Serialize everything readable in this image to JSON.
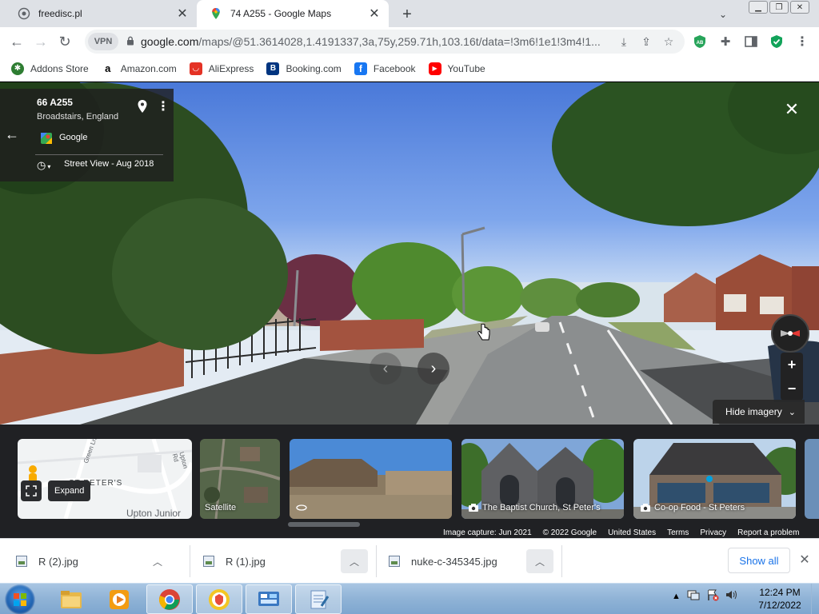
{
  "tabs": [
    {
      "title": "freedisc.pl"
    },
    {
      "title": "74 A255 - Google Maps"
    }
  ],
  "omnibox": {
    "vpn_label": "VPN",
    "url_host": "google.com",
    "url_path": "/maps/@51.3614028,1.4191337,3a,75y,259.71h,103.16t/data=!3m6!1e1!3m4!1..."
  },
  "bookmarks": [
    {
      "label": "Addons Store",
      "icon": "addons-icon",
      "color": "#2e7d32"
    },
    {
      "label": "Amazon.com",
      "icon": "amazon-icon",
      "color": "#000000"
    },
    {
      "label": "AliExpress",
      "icon": "aliexpress-icon",
      "color": "#e43225"
    },
    {
      "label": "Booking.com",
      "icon": "booking-icon",
      "color": "#003580"
    },
    {
      "label": "Facebook",
      "icon": "facebook-icon",
      "color": "#1877f2"
    },
    {
      "label": "YouTube",
      "icon": "youtube-icon",
      "color": "#ff0000"
    }
  ],
  "streetview": {
    "address": "66 A255",
    "locality": "Broadstairs, England",
    "provider": "Google",
    "capture": "Street View - Aug 2018",
    "hide_imagery": "Hide imagery",
    "zoom_in": "+",
    "zoom_out": "−"
  },
  "strip": {
    "map_labels": {
      "street1": "Green Ln",
      "street2": "Upton Rd",
      "area": "ST PETER'S",
      "school": "Upton Junior"
    },
    "expand": "Expand",
    "satellite": "Satellite",
    "photos": [
      {
        "label": ""
      },
      {
        "label": "The Baptist Church, St Peter's"
      },
      {
        "label": "Co-op Food - St Peters"
      }
    ],
    "footer": {
      "capture": "Image capture: Jun 2021",
      "copyright": "© 2022 Google",
      "country": "United States",
      "terms": "Terms",
      "privacy": "Privacy",
      "report": "Report a problem"
    }
  },
  "downloads": {
    "items": [
      {
        "name": "R (2).jpg"
      },
      {
        "name": "R (1).jpg"
      },
      {
        "name": "nuke-c-345345.jpg"
      }
    ],
    "show_all": "Show all"
  },
  "taskbar": {
    "time": "12:24 PM",
    "date": "7/12/2022"
  }
}
